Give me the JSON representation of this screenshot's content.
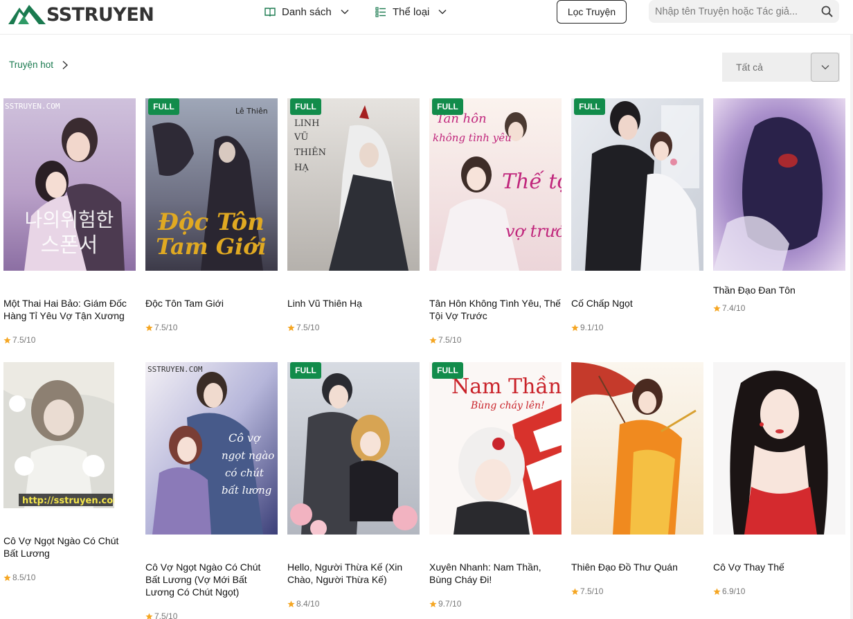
{
  "header": {
    "logo_text": "SSTRUYEN",
    "nav": [
      {
        "label": "Danh sách",
        "icon": "book-open-icon"
      },
      {
        "label": "Thể loại",
        "icon": "list-icon"
      }
    ],
    "filter_button": "Lọc Truyện",
    "search": {
      "placeholder": "Nhập tên Truyện hoặc Tác giả..."
    }
  },
  "section": {
    "title": "Truyện hot",
    "select_value": "Tất cả"
  },
  "colors": {
    "accent": "#1a7a4f",
    "badge": "#128c4b",
    "star": "#f5a623"
  },
  "books": [
    {
      "title": "Một Thai Hai Bảo: Giám Đốc Hàng Tỉ Yêu Vợ Tận Xương",
      "rating": "7.5/10",
      "full": "",
      "cover_text": "sstruyen.com"
    },
    {
      "title": "Độc Tôn Tam Giới",
      "rating": "7.5/10",
      "full": "FULL",
      "cover_text": "Độc Tôn Tam Giới"
    },
    {
      "title": "Linh Vũ Thiên Hạ",
      "rating": "7.5/10",
      "full": "FULL",
      "cover_text": "Linh Vũ Thiên Hạ"
    },
    {
      "title": "Tân Hôn Không Tình Yêu, Thế Tội Vợ Trước",
      "rating": "7.5/10",
      "full": "FULL",
      "cover_text": "Thế tội vợ trước"
    },
    {
      "title": "Cố Chấp Ngọt",
      "rating": "9.1/10",
      "full": "FULL",
      "cover_text": ""
    },
    {
      "title": "Thần Đạo Đan Tôn",
      "rating": "7.4/10",
      "full": "",
      "cover_text": ""
    },
    {
      "title": "Cô Vợ Ngọt Ngào Có Chút Bất Lương",
      "rating": "8.5/10",
      "full": "",
      "cover_text": "http://sstruyen.com"
    },
    {
      "title": "Cô Vợ Ngọt Ngào Có Chút Bất Lương (Vợ Mới Bất Lương Có Chút Ngọt)",
      "rating": "7.5/10",
      "full": "",
      "cover_text": "Cô vợ ngọt ngào có chút bất lương"
    },
    {
      "title": "Hello, Người Thừa Kế (Xin Chào, Người Thừa Kế)",
      "rating": "8.4/10",
      "full": "FULL",
      "cover_text": ""
    },
    {
      "title": "Xuyên Nhanh: Nam Thần, Bùng Cháy Đi!",
      "rating": "9.7/10",
      "full": "FULL",
      "cover_text": "Nam Thần! Bùng cháy lên!"
    },
    {
      "title": "Thiên Đạo Đồ Thư Quán",
      "rating": "7.5/10",
      "full": "",
      "cover_text": ""
    },
    {
      "title": "Cô Vợ Thay Thế",
      "rating": "6.9/10",
      "full": "",
      "cover_text": ""
    }
  ]
}
